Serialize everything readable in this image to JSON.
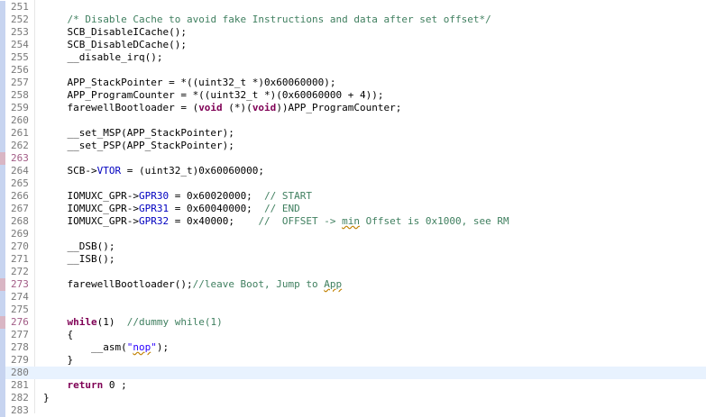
{
  "editor": {
    "colors": {
      "keyword": "#7f0055",
      "comment": "#3f7f5f",
      "string": "#2a00ff",
      "member": "#0000c0",
      "line_number": "#787878",
      "current_line": "#e8f2fe"
    },
    "current_line": "280",
    "lines": [
      {
        "num": "251",
        "seg": []
      },
      {
        "num": "252",
        "seg": [
          {
            "t": "    "
          },
          {
            "t": "/* Disable Cache to avoid fake Instructions and data after set offset*/",
            "c": "cm"
          }
        ]
      },
      {
        "num": "253",
        "seg": [
          {
            "t": "    SCB_DisableICache();"
          }
        ]
      },
      {
        "num": "254",
        "seg": [
          {
            "t": "    SCB_DisableDCache();"
          }
        ]
      },
      {
        "num": "255",
        "seg": [
          {
            "t": "    __disable_irq();"
          }
        ]
      },
      {
        "num": "256",
        "seg": []
      },
      {
        "num": "257",
        "seg": [
          {
            "t": "    APP_StackPointer = *((uint32_t *)0x60060000);"
          }
        ]
      },
      {
        "num": "258",
        "seg": [
          {
            "t": "    APP_ProgramCounter = *((uint32_t *)(0x60060000 + 4));"
          }
        ]
      },
      {
        "num": "259",
        "seg": [
          {
            "t": "    farewellBootloader = ("
          },
          {
            "t": "void",
            "c": "kw"
          },
          {
            "t": " (*)("
          },
          {
            "t": "void",
            "c": "kw"
          },
          {
            "t": "))APP_ProgramCounter;"
          }
        ]
      },
      {
        "num": "260",
        "seg": []
      },
      {
        "num": "261",
        "seg": [
          {
            "t": "    __set_MSP(APP_StackPointer);"
          }
        ]
      },
      {
        "num": "262",
        "seg": [
          {
            "t": "    __set_PSP(APP_StackPointer);"
          }
        ]
      },
      {
        "num": "263",
        "seg": [],
        "edited": true
      },
      {
        "num": "264",
        "seg": [
          {
            "t": "    SCB->"
          },
          {
            "t": "VTOR",
            "c": "mem"
          },
          {
            "t": " = (uint32_t)0x60060000;"
          }
        ]
      },
      {
        "num": "265",
        "seg": []
      },
      {
        "num": "266",
        "seg": [
          {
            "t": "    IOMUXC_GPR->"
          },
          {
            "t": "GPR30",
            "c": "mem"
          },
          {
            "t": " = 0x60020000;  "
          },
          {
            "t": "// START",
            "c": "cm"
          }
        ]
      },
      {
        "num": "267",
        "seg": [
          {
            "t": "    IOMUXC_GPR->"
          },
          {
            "t": "GPR31",
            "c": "mem"
          },
          {
            "t": " = 0x60040000;  "
          },
          {
            "t": "// END",
            "c": "cm"
          }
        ]
      },
      {
        "num": "268",
        "seg": [
          {
            "t": "    IOMUXC_GPR->"
          },
          {
            "t": "GPR32",
            "c": "mem"
          },
          {
            "t": " = 0x40000;    "
          },
          {
            "t": "//  OFFSET -> ",
            "c": "cm"
          },
          {
            "t": "min",
            "c": "cmsq"
          },
          {
            "t": " Offset is 0x1000, see RM",
            "c": "cm"
          }
        ]
      },
      {
        "num": "269",
        "seg": []
      },
      {
        "num": "270",
        "seg": [
          {
            "t": "    __DSB();"
          }
        ]
      },
      {
        "num": "271",
        "seg": [
          {
            "t": "    __ISB();"
          }
        ]
      },
      {
        "num": "272",
        "seg": []
      },
      {
        "num": "273",
        "seg": [
          {
            "t": "    farewellBootloader();"
          },
          {
            "t": "//leave Boot, Jump to ",
            "c": "cm"
          },
          {
            "t": "App",
            "c": "cmsq"
          }
        ],
        "edited": true
      },
      {
        "num": "274",
        "seg": []
      },
      {
        "num": "275",
        "seg": []
      },
      {
        "num": "276",
        "seg": [
          {
            "t": "    "
          },
          {
            "t": "while",
            "c": "kw"
          },
          {
            "t": "(1)  "
          },
          {
            "t": "//dummy while(1)",
            "c": "cm"
          }
        ],
        "edited": true
      },
      {
        "num": "277",
        "seg": [
          {
            "t": "    {"
          }
        ]
      },
      {
        "num": "278",
        "seg": [
          {
            "t": "        __asm("
          },
          {
            "t": "\"",
            "c": "st"
          },
          {
            "t": "nop",
            "c": "stsq"
          },
          {
            "t": "\"",
            "c": "st"
          },
          {
            "t": ");"
          }
        ]
      },
      {
        "num": "279",
        "seg": [
          {
            "t": "    }"
          }
        ]
      },
      {
        "num": "280",
        "seg": []
      },
      {
        "num": "281",
        "seg": [
          {
            "t": "    "
          },
          {
            "t": "return",
            "c": "kw"
          },
          {
            "t": " 0 ;"
          }
        ]
      },
      {
        "num": "282",
        "seg": [
          {
            "t": "}"
          }
        ]
      },
      {
        "num": "283",
        "seg": []
      }
    ]
  }
}
